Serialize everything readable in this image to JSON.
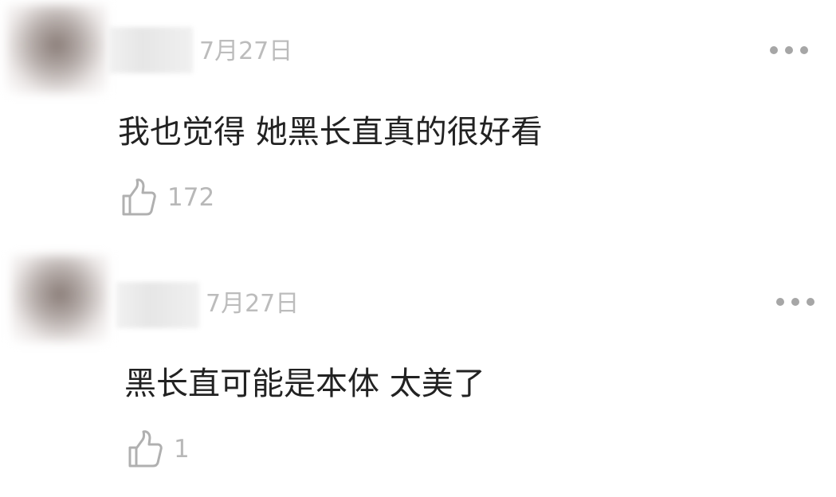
{
  "comments": [
    {
      "date": "7月27日",
      "text": "我也觉得 她黑长直真的很好看",
      "likes": "172",
      "more_icon": "more-horizontal-icon",
      "like_icon": "thumbs-up-icon"
    },
    {
      "date": "7月27日",
      "text": "黑长直可能是本体 太美了",
      "likes": "1",
      "more_icon": "more-horizontal-icon",
      "like_icon": "thumbs-up-icon"
    }
  ]
}
